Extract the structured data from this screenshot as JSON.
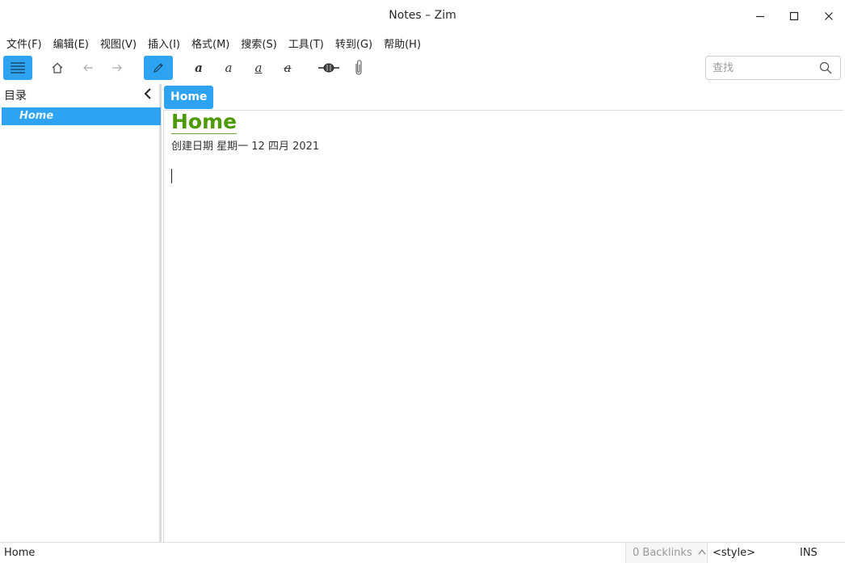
{
  "window": {
    "title": "Notes – Zim"
  },
  "menu": [
    "文件(F)",
    "编辑(E)",
    "视图(V)",
    "插入(I)",
    "格式(M)",
    "搜索(S)",
    "工具(T)",
    "转到(G)",
    "帮助(H)"
  ],
  "toolbar": {
    "icons": [
      "menu-icon",
      "home-icon",
      "back-arrow-icon",
      "forward-arrow-icon",
      "edit-pencil-icon",
      "link-icon",
      "attachment-icon"
    ],
    "format_glyph": "a"
  },
  "search": {
    "placeholder": "查找",
    "value": ""
  },
  "sidebar": {
    "title": "目录",
    "items": [
      {
        "label": "Home",
        "selected": true
      }
    ]
  },
  "pathbar": {
    "current": "Home"
  },
  "page": {
    "heading": "Home",
    "meta": "创建日期 星期一 12 四月 2021"
  },
  "statusbar": {
    "page": "Home",
    "backlinks": "0 Backlinks",
    "style": "<style>",
    "mode": "INS"
  },
  "colors": {
    "accent": "#2ea3f2",
    "heading": "#4e9a06"
  }
}
